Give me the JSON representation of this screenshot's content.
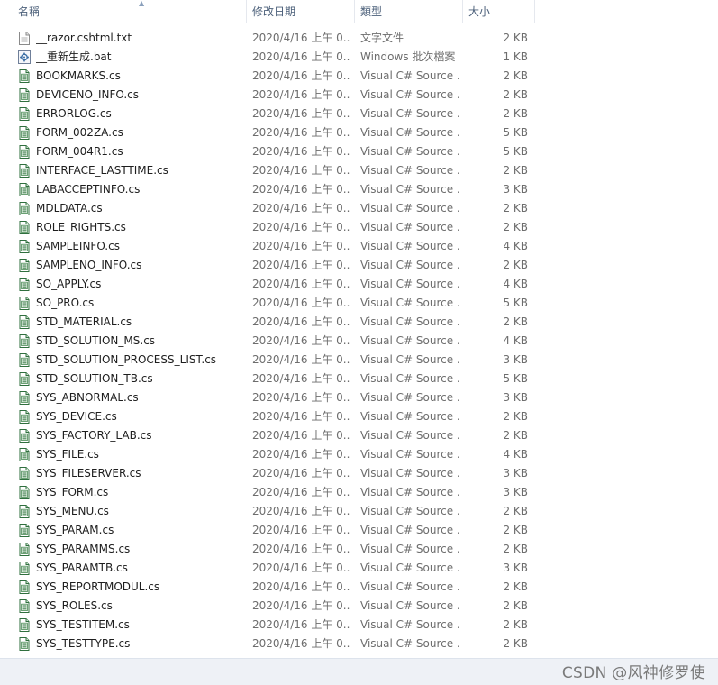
{
  "header": {
    "name_label": "名稱",
    "date_label": "修改日期",
    "type_label": "類型",
    "size_label": "大小"
  },
  "files": [
    {
      "name": "__razor.cshtml.txt",
      "date": "2020/4/16 上午 0...",
      "type": "文字文件",
      "size": "2 KB",
      "icon": "text-file-icon"
    },
    {
      "name": "__重新生成.bat",
      "date": "2020/4/16 上午 0...",
      "type": "Windows 批次檔案",
      "size": "1 KB",
      "icon": "batch-file-icon"
    },
    {
      "name": "BOOKMARKS.cs",
      "date": "2020/4/16 上午 0...",
      "type": "Visual C# Source ...",
      "size": "2 KB",
      "icon": "cs-file-icon"
    },
    {
      "name": "DEVICENO_INFO.cs",
      "date": "2020/4/16 上午 0...",
      "type": "Visual C# Source ...",
      "size": "2 KB",
      "icon": "cs-file-icon"
    },
    {
      "name": "ERRORLOG.cs",
      "date": "2020/4/16 上午 0...",
      "type": "Visual C# Source ...",
      "size": "2 KB",
      "icon": "cs-file-icon"
    },
    {
      "name": "FORM_002ZA.cs",
      "date": "2020/4/16 上午 0...",
      "type": "Visual C# Source ...",
      "size": "5 KB",
      "icon": "cs-file-icon"
    },
    {
      "name": "FORM_004R1.cs",
      "date": "2020/4/16 上午 0...",
      "type": "Visual C# Source ...",
      "size": "5 KB",
      "icon": "cs-file-icon"
    },
    {
      "name": "INTERFACE_LASTTIME.cs",
      "date": "2020/4/16 上午 0...",
      "type": "Visual C# Source ...",
      "size": "2 KB",
      "icon": "cs-file-icon"
    },
    {
      "name": "LABACCEPTINFO.cs",
      "date": "2020/4/16 上午 0...",
      "type": "Visual C# Source ...",
      "size": "3 KB",
      "icon": "cs-file-icon"
    },
    {
      "name": "MDLDATA.cs",
      "date": "2020/4/16 上午 0...",
      "type": "Visual C# Source ...",
      "size": "2 KB",
      "icon": "cs-file-icon"
    },
    {
      "name": "ROLE_RIGHTS.cs",
      "date": "2020/4/16 上午 0...",
      "type": "Visual C# Source ...",
      "size": "2 KB",
      "icon": "cs-file-icon"
    },
    {
      "name": "SAMPLEINFO.cs",
      "date": "2020/4/16 上午 0...",
      "type": "Visual C# Source ...",
      "size": "4 KB",
      "icon": "cs-file-icon"
    },
    {
      "name": "SAMPLENO_INFO.cs",
      "date": "2020/4/16 上午 0...",
      "type": "Visual C# Source ...",
      "size": "2 KB",
      "icon": "cs-file-icon"
    },
    {
      "name": "SO_APPLY.cs",
      "date": "2020/4/16 上午 0...",
      "type": "Visual C# Source ...",
      "size": "4 KB",
      "icon": "cs-file-icon"
    },
    {
      "name": "SO_PRO.cs",
      "date": "2020/4/16 上午 0...",
      "type": "Visual C# Source ...",
      "size": "5 KB",
      "icon": "cs-file-icon"
    },
    {
      "name": "STD_MATERIAL.cs",
      "date": "2020/4/16 上午 0...",
      "type": "Visual C# Source ...",
      "size": "2 KB",
      "icon": "cs-file-icon"
    },
    {
      "name": "STD_SOLUTION_MS.cs",
      "date": "2020/4/16 上午 0...",
      "type": "Visual C# Source ...",
      "size": "4 KB",
      "icon": "cs-file-icon"
    },
    {
      "name": "STD_SOLUTION_PROCESS_LIST.cs",
      "date": "2020/4/16 上午 0...",
      "type": "Visual C# Source ...",
      "size": "3 KB",
      "icon": "cs-file-icon"
    },
    {
      "name": "STD_SOLUTION_TB.cs",
      "date": "2020/4/16 上午 0...",
      "type": "Visual C# Source ...",
      "size": "5 KB",
      "icon": "cs-file-icon"
    },
    {
      "name": "SYS_ABNORMAL.cs",
      "date": "2020/4/16 上午 0...",
      "type": "Visual C# Source ...",
      "size": "3 KB",
      "icon": "cs-file-icon"
    },
    {
      "name": "SYS_DEVICE.cs",
      "date": "2020/4/16 上午 0...",
      "type": "Visual C# Source ...",
      "size": "2 KB",
      "icon": "cs-file-icon"
    },
    {
      "name": "SYS_FACTORY_LAB.cs",
      "date": "2020/4/16 上午 0...",
      "type": "Visual C# Source ...",
      "size": "2 KB",
      "icon": "cs-file-icon"
    },
    {
      "name": "SYS_FILE.cs",
      "date": "2020/4/16 上午 0...",
      "type": "Visual C# Source ...",
      "size": "4 KB",
      "icon": "cs-file-icon"
    },
    {
      "name": "SYS_FILESERVER.cs",
      "date": "2020/4/16 上午 0...",
      "type": "Visual C# Source ...",
      "size": "3 KB",
      "icon": "cs-file-icon"
    },
    {
      "name": "SYS_FORM.cs",
      "date": "2020/4/16 上午 0...",
      "type": "Visual C# Source ...",
      "size": "3 KB",
      "icon": "cs-file-icon"
    },
    {
      "name": "SYS_MENU.cs",
      "date": "2020/4/16 上午 0...",
      "type": "Visual C# Source ...",
      "size": "2 KB",
      "icon": "cs-file-icon"
    },
    {
      "name": "SYS_PARAM.cs",
      "date": "2020/4/16 上午 0...",
      "type": "Visual C# Source ...",
      "size": "2 KB",
      "icon": "cs-file-icon"
    },
    {
      "name": "SYS_PARAMMS.cs",
      "date": "2020/4/16 上午 0...",
      "type": "Visual C# Source ...",
      "size": "2 KB",
      "icon": "cs-file-icon"
    },
    {
      "name": "SYS_PARAMTB.cs",
      "date": "2020/4/16 上午 0...",
      "type": "Visual C# Source ...",
      "size": "3 KB",
      "icon": "cs-file-icon"
    },
    {
      "name": "SYS_REPORTMODUL.cs",
      "date": "2020/4/16 上午 0...",
      "type": "Visual C# Source ...",
      "size": "2 KB",
      "icon": "cs-file-icon"
    },
    {
      "name": "SYS_ROLES.cs",
      "date": "2020/4/16 上午 0...",
      "type": "Visual C# Source ...",
      "size": "2 KB",
      "icon": "cs-file-icon"
    },
    {
      "name": "SYS_TESTITEM.cs",
      "date": "2020/4/16 上午 0...",
      "type": "Visual C# Source ...",
      "size": "2 KB",
      "icon": "cs-file-icon"
    },
    {
      "name": "SYS_TESTTYPE.cs",
      "date": "2020/4/16 上午 0...",
      "type": "Visual C# Source ...",
      "size": "2 KB",
      "icon": "cs-file-icon"
    }
  ],
  "watermark": "CSDN @风神修罗使",
  "colors": {
    "header_text": "#4c607a",
    "row_text": "#1e1e1e",
    "meta_text": "#6d6d6d",
    "bottom_bar": "#eef1f6"
  }
}
